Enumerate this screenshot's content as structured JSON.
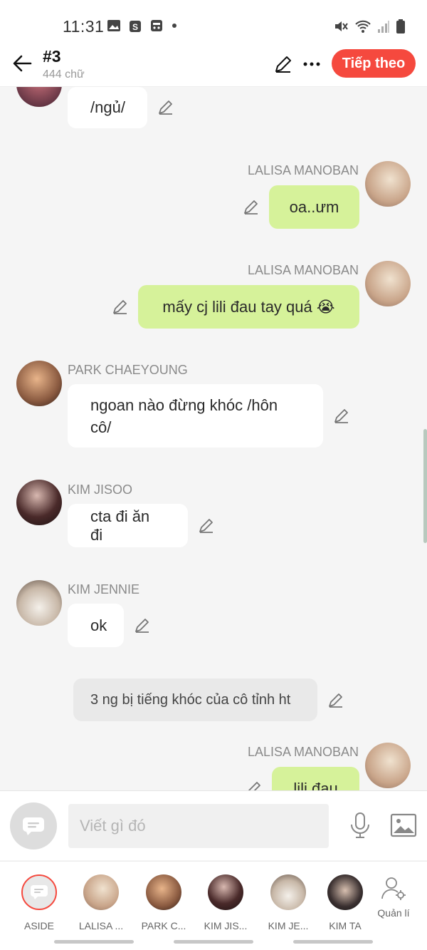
{
  "status": {
    "time": "11:31"
  },
  "header": {
    "title": "#3",
    "subtitle": "444 chữ",
    "next_label": "Tiếp theo"
  },
  "messages": [
    {
      "text": "/ngủ/"
    },
    {
      "name": "LALISA MANOBAN",
      "text": "oa..ưm"
    },
    {
      "name": "LALISA MANOBAN",
      "text": "mấy cj lili đau tay quá 😭"
    },
    {
      "name": "PARK CHAEYOUNG",
      "line1": "ngoan nào đừng khóc /hôn",
      "line2": "cô/"
    },
    {
      "name": "KIM JISOO",
      "text": "cta đi ăn đi"
    },
    {
      "name": "KIM JENNIE",
      "text": "ok"
    },
    {
      "text": "3 ng bị tiếng khóc của cô tỉnh ht"
    },
    {
      "name": "LALISA MANOBAN",
      "text": "lili đau"
    }
  ],
  "composer": {
    "placeholder": "Viết gì đó"
  },
  "characters": [
    {
      "label": "ASIDE"
    },
    {
      "label": "LALISA ..."
    },
    {
      "label": "PARK C..."
    },
    {
      "label": "KIM JIS..."
    },
    {
      "label": "KIM JE..."
    },
    {
      "label": "KIM TA"
    },
    {
      "label": "Quản lí"
    }
  ],
  "colors": {
    "accent": "#f5493e",
    "user_bubble": "#d6f29a",
    "bubble": "#ffffff",
    "background": "#f5f5f5"
  }
}
